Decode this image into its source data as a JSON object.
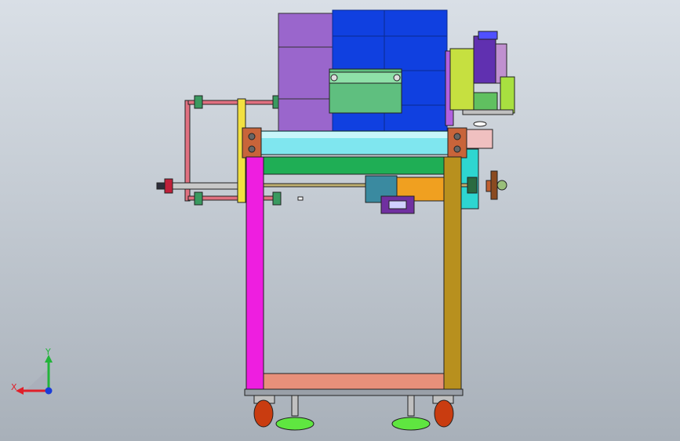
{
  "viewport": {
    "name": "cad-model-viewport",
    "background_top": "#d9dfe6",
    "background_bottom": "#a8b0b9"
  },
  "triad": {
    "x_label": "X",
    "y_label": "Y",
    "x_color": "#e0202a",
    "y_color": "#22b43a",
    "z_color": "#1a3cd8"
  },
  "colors": {
    "frame_left_post": "#ee1ee0",
    "frame_right_post": "#b8901e",
    "frame_bottom_bar": "#e8907a",
    "upper_green_plate": "#1fae55",
    "roller": "#7fe6ef",
    "purple_hopper": "#9a66cc",
    "blue_hopper": "#1040e0",
    "yellow_bar": "#f2e040",
    "motor": "#3a8aa0",
    "wheels": "#c93c10",
    "feet": "#5fe640",
    "cyan_side": "#2ed6d0"
  }
}
